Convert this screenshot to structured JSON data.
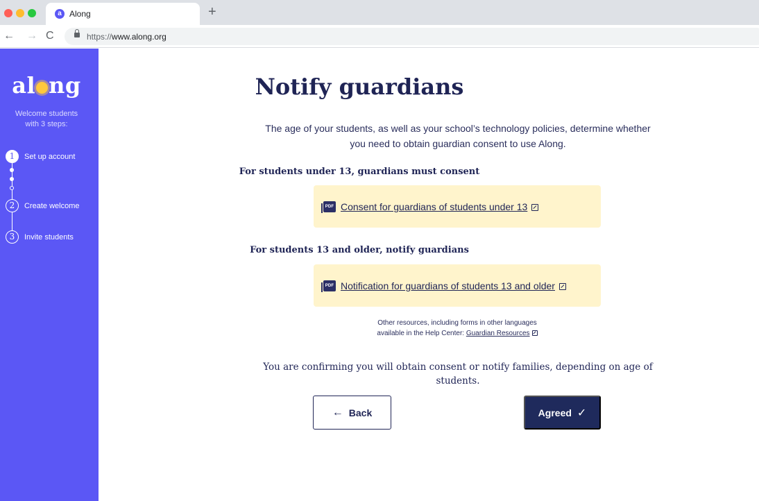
{
  "browser": {
    "tab_title": "Along",
    "tab_favicon": "a",
    "new_tab": "+",
    "url_scheme": "https://",
    "url_host": "www.along.org"
  },
  "sidebar": {
    "logo": {
      "left": "al",
      "right": "ng"
    },
    "welcome_line1": "Welcome students",
    "welcome_line2": "with 3  steps:",
    "steps": [
      {
        "number": "1",
        "label": "Set up account",
        "state": "current"
      },
      {
        "number": "2",
        "label": "Create welcome",
        "state": "upcoming"
      },
      {
        "number": "3",
        "label": "Invite students",
        "state": "upcoming"
      }
    ]
  },
  "main": {
    "title": "Notify guardians",
    "intro": "The age of your students, as well as your school’s technology policies, determine whether you need to obtain guardian consent to use Along.",
    "under13_heading": "For students under 13, guardians must consent",
    "under13_link": "Consent for guardians of students under 13",
    "over13_heading": "For students 13 and older, notify guardians",
    "over13_link": "Notification for guardians of students 13 and older",
    "pdf_label": "PDF",
    "resources_line1": "Other resources, including forms in other languages",
    "resources_line2": "available in the Help Center:",
    "resources_link": "Guardian Resources",
    "confirm_text": "You are confirming you will obtain consent or notify families, depending on age of students.",
    "back_label": "Back",
    "agree_label": "Agreed"
  },
  "colors": {
    "sidebar_bg": "#5b57f5",
    "navy": "#1f2a5c",
    "card_bg": "#fff4cc",
    "sun": "#ffc83d"
  }
}
